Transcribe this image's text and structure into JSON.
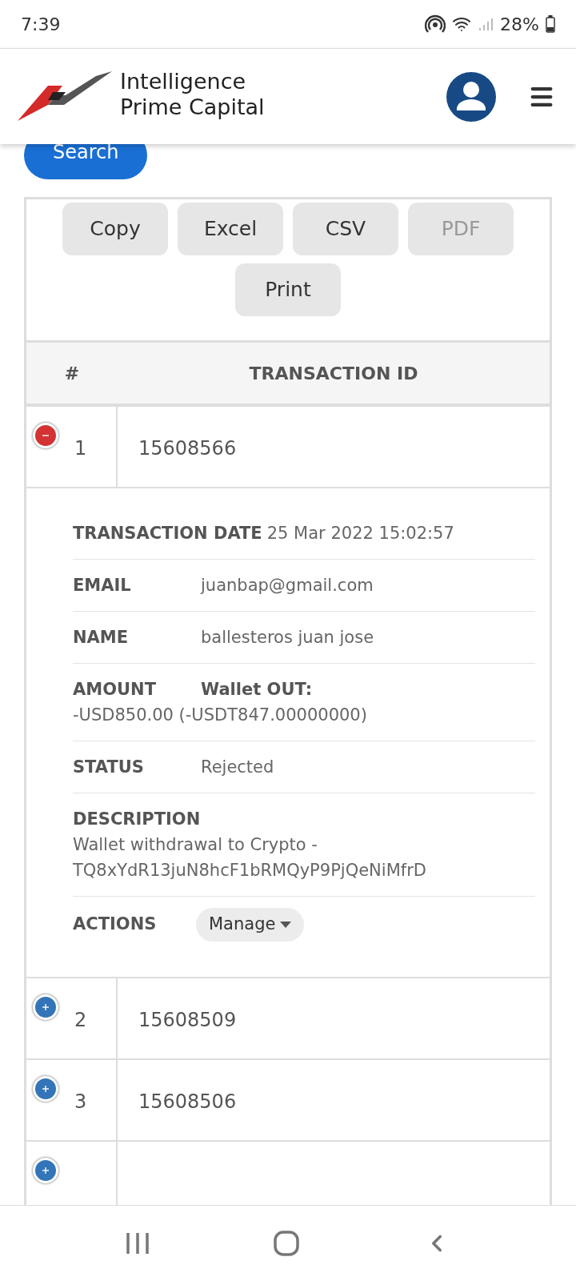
{
  "status_bar": {
    "time": "7:39",
    "battery": "28%"
  },
  "header": {
    "logo_line_1": "Intelligence",
    "logo_line_2": "Prime Capital"
  },
  "search_button": "Search",
  "export_buttons": [
    {
      "label": "Copy",
      "disabled": false
    },
    {
      "label": "Excel",
      "disabled": false
    },
    {
      "label": "CSV",
      "disabled": false
    },
    {
      "label": "PDF",
      "disabled": true
    },
    {
      "label": "Print",
      "disabled": false
    }
  ],
  "table": {
    "columns": [
      "#",
      "TRANSACTION ID"
    ],
    "rows": [
      {
        "number": "1",
        "transaction_id": "15608566",
        "expanded": true,
        "details": [
          {
            "label": "TRANSACTION DATE",
            "value": "25 Mar 2022 15:02:57",
            "bold": false
          },
          {
            "label": "EMAIL",
            "value": "juanbap@gmail.com",
            "bold": false
          },
          {
            "label": "NAME",
            "value": "ballesteros juan jose",
            "bold": false
          },
          {
            "label": "AMOUNT",
            "value": "Wallet OUT:",
            "bold": true,
            "continuation": "-USD850.00 (-USDT847.00000000)"
          },
          {
            "label": "STATUS",
            "value": "Rejected",
            "bold": false
          },
          {
            "label": "DESCRIPTION",
            "value": "Wallet withdrawal to Crypto - TQ8xYdR13juN8hcF1bRMQyP9PjQeNiMfrD",
            "bold": false
          }
        ],
        "actions": {
          "label": "ACTIONS",
          "button": "Manage"
        }
      },
      {
        "number": "2",
        "transaction_id": "15608509",
        "expanded": false
      },
      {
        "number": "3",
        "transaction_id": "15608506",
        "expanded": false
      },
      {
        "expanded": false
      }
    ]
  }
}
